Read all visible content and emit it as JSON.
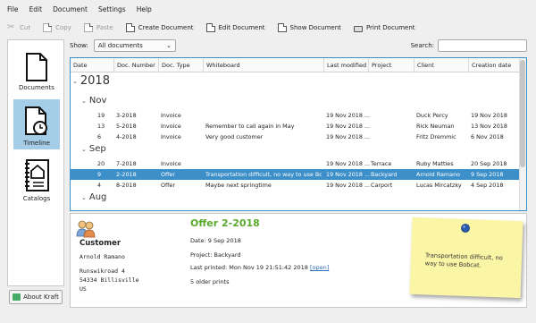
{
  "menu": [
    "File",
    "Edit",
    "Document",
    "Settings",
    "Help"
  ],
  "toolbar": {
    "cut": "Cut",
    "copy": "Copy",
    "paste": "Paste",
    "create": "Create Document",
    "edit": "Edit Document",
    "show": "Show Document",
    "print": "Print Document"
  },
  "filter": {
    "show_label": "Show:",
    "show_value": "All documents",
    "search_label": "Search:",
    "search_value": ""
  },
  "sidebar": {
    "items": [
      {
        "label": "Documents",
        "icon": "document-icon",
        "active": false
      },
      {
        "label": "Timeline",
        "icon": "timeline-icon",
        "active": true
      },
      {
        "label": "Catalogs",
        "icon": "catalog-icon",
        "active": false
      }
    ],
    "about": "About Kraft"
  },
  "table": {
    "columns": [
      "Date",
      "Doc. Number",
      "Doc. Type",
      "Whiteboard",
      "Last modified",
      "Project",
      "Client",
      "Creation date"
    ],
    "year": "2018",
    "months": [
      "Nov",
      "Sep",
      "Aug"
    ],
    "nov_rows": [
      [
        "19",
        "3-2018",
        "Invoice",
        "",
        "19 Nov 2018 ...",
        "",
        "Duck Percy",
        "19 Nov 2018"
      ],
      [
        "13",
        "5-2018",
        "Invoice",
        "Remember to call again in May",
        "19 Nov 2018 ...",
        "",
        "Rick Neuman",
        "13 Nov 2018"
      ],
      [
        "6",
        "4-2018",
        "Invoice",
        "Very good customer",
        "19 Nov 2018 ...",
        "",
        "Fritz Dremmic",
        "6 Nov 2018"
      ]
    ],
    "sep_rows": [
      [
        "20",
        "7-2018",
        "Invoice",
        "",
        "19 Nov 2018 ...",
        "Terrace",
        "Ruby Matties",
        "20 Sep 2018"
      ],
      [
        "9",
        "2-2018",
        "Offer",
        "Transportation difficult, no way to use Bo...",
        "19 Nov 2018 ...",
        "Backyard",
        "Arnold Ramano",
        "9 Sep 2018"
      ],
      [
        "4",
        "8-2018",
        "Offer",
        "Maybe next springtime",
        "19 Nov 2018 ...",
        "Carport",
        "Lucas Mircatzky",
        "4 Sep 2018"
      ]
    ]
  },
  "detail": {
    "customer_heading": "Customer",
    "customer_name": "Arnold Ramano",
    "address_line1": "Runswikroad 4",
    "address_line2": "54334 Billisville",
    "address_line3": "US",
    "doc_title": "Offer 2-2018",
    "date_line": "Date: 9 Sep 2018",
    "project_line": "Project: Backyard",
    "printed_line": "Last printed: Mon Nov 19 21:51:42 2018",
    "open_link": "[open]",
    "older_prints": "5 older prints",
    "note_text": "Transportation difficult, no way to use Bobcat."
  },
  "colors": {
    "selection": "#3d8fc9",
    "title_green": "#5aaa2a",
    "note_yellow": "#fbf5a6",
    "sidebar_active": "#a6cde8"
  }
}
